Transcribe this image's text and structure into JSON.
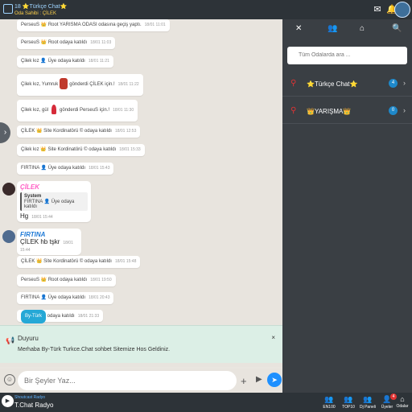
{
  "header": {
    "room_title": "⭐Türkçe Chat⭐",
    "room_prefix": "18",
    "room_sub": "Oda Sahibi : ÇİLEK"
  },
  "messages": [
    {
      "text": "PerseuS 👑 Root YARISMA ODASI odasına geçiş yaptı.",
      "time": "18/01 11:01"
    },
    {
      "text": "PerseuS 👑 Root odaya katıldı",
      "time": "18/01 11:03"
    },
    {
      "text": "Çilek kız 👤 Üye odaya katıldı",
      "time": "18/01 11:21"
    },
    {
      "text_a": "Çilek kız, Yumruk",
      "text_b": "gönderdi ÇİLEK için.!",
      "time": "18/01 11:22"
    },
    {
      "text_a": "Çilek kız, gül",
      "text_b": "gönderdi PerseuS için.!",
      "time": "18/01 11:30"
    },
    {
      "text": "ÇİLEK 👑 Site Kordinatörü © odaya katıldı",
      "time": "18/01 12:53"
    },
    {
      "text": "Çilek kız 👑 Site Kordinatörü © odaya katıldı",
      "time": "18/01 15:33"
    },
    {
      "text": "FIRTINA 👤 Üye odaya katıldı",
      "time": "18/01 15:43"
    }
  ],
  "card1": {
    "name": "ÇİLEK",
    "quote_title": "System",
    "quote_body": "FIRTINA 👤 Üye odaya katıldı",
    "text": "Hg",
    "time": "18/01 15:44"
  },
  "card2": {
    "name": "FIRTINA",
    "text": "ÇİLEK hb tşkr",
    "time": "18/01 15:44"
  },
  "messages2": [
    {
      "text": "ÇİLEK 👑 Site Kordinatörü © odaya katıldı",
      "time": "18/01 15:48"
    },
    {
      "text": "PerseuS 👑 Root odaya katıldı",
      "time": "18/01 19:50"
    },
    {
      "text": "FIRTINA 👤 Üye odaya katıldı",
      "time": "18/01 20:43"
    }
  ],
  "last_msg": {
    "tag": "By-Türk",
    "text": "odaya katıldı",
    "time": "18/01 21:33"
  },
  "announcement": {
    "title": "Duyuru",
    "body": "Merhaba By-Türk Turkce.Chat sohbet Sitemize Hos Geldiniz."
  },
  "composer": {
    "placeholder": "Bir Şeyler Yaz..."
  },
  "sidebar": {
    "search_placeholder": "Tüm Odalarda ara ...",
    "rooms": [
      {
        "name": "⭐Türkçe Chat⭐",
        "count": "4"
      },
      {
        "name": "👑YARIŞMA👑",
        "count": "0"
      }
    ]
  },
  "radio": {
    "label": "Shoutcast Radyo",
    "name": "T.Chat Radyo"
  },
  "nav": [
    {
      "label": "EN100"
    },
    {
      "label": "TOP10"
    },
    {
      "label": "Dj Paneli"
    },
    {
      "label": "Üyeler",
      "badge": "4"
    },
    {
      "label": "Odalar"
    }
  ],
  "colors": {
    "accent": "#1e90ff",
    "header": "#2d3338",
    "panel": "#3a3f44",
    "pin": "#e03434"
  }
}
